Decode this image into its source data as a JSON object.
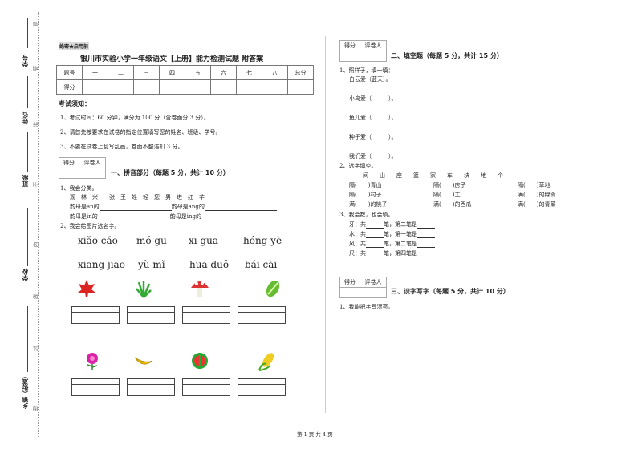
{
  "margin": {
    "labels": [
      "学号",
      "姓名",
      "班级",
      "学校",
      "乡镇（街道）"
    ],
    "seal_chars": [
      "题",
      "答",
      "准",
      "不",
      "内",
      "线",
      "封",
      "密"
    ]
  },
  "header": {
    "stamp": "绝密★启用前",
    "title": "银川市实验小学一年级语文【上册】能力检测试题 附答案"
  },
  "score_table": {
    "headers": [
      "题号",
      "一",
      "二",
      "三",
      "四",
      "五",
      "六",
      "七",
      "八",
      "总分"
    ],
    "row_label": "得分"
  },
  "notice": {
    "title": "考试须知：",
    "items": [
      "1、考试时间：60 分钟，满分为 100 分（含卷面分 3 分）。",
      "2、请首先按要求在试卷的指定位置填写您的姓名、班级、学号。",
      "3、不要在试卷上乱写乱画，卷面不整洁扣 3 分。"
    ]
  },
  "grader": {
    "score": "得分",
    "reviewer": "评卷人"
  },
  "section1": {
    "title": "一、拼音部分（每题 5 分，共计 10 分）",
    "q1": "1、我会分类。",
    "chars": "观　林　兴　　张　王　姓　轻　您　男　进　红　芊",
    "rows": [
      [
        "韵母是an的",
        "韵母是ang的"
      ],
      [
        "韵母是in的",
        "韵母是ing的"
      ]
    ],
    "q2": "2、我会给图片选名字。",
    "pinyin": [
      "xiǎo cǎo",
      "mó gu",
      "xī guā",
      "hóng yè",
      "xiāng jiāo",
      "yù mǐ",
      "huā duǒ",
      "bái cài"
    ],
    "pictures": [
      "maple-leaf",
      "grass",
      "mushroom",
      "cabbage",
      "flower",
      "banana",
      "watermelon",
      "corn"
    ]
  },
  "section2": {
    "title": "二、填空题（每题 5 分，共计 15 分）",
    "q1": "1、照样子，填一填：",
    "example": "白云爱（蓝天）。",
    "blanks": [
      "小鸟爱（　　　）。",
      "鱼儿爱（　　　）。",
      "种子爱（　　　）。",
      "我们爱（　　　）。"
    ],
    "q2": "2、选字填空。",
    "choices": "间　　山　　座　　篮　　家　　车　　块　　地　　个",
    "fill": [
      [
        "隔(　　)青山",
        "隔(　　)房子",
        "隔(　　)草地"
      ],
      [
        "隔(　　)村子",
        "隔(　　)工厂",
        "满(　　)的绿树"
      ],
      [
        "满(　　)的桃子",
        "满(　　)的西瓜",
        "满(　　)的青菜"
      ]
    ],
    "q3": "3、我会数，也会填。",
    "strokes": [
      [
        "牙：共",
        "笔，第二笔是"
      ],
      [
        "水：共",
        "笔，第一笔是"
      ],
      [
        "风：共",
        "笔，第二笔是"
      ],
      [
        "尺：共",
        "笔，第四笔是"
      ]
    ]
  },
  "section3": {
    "title": "三、识字写字（每题 5 分，共计 10 分）",
    "q1": "1、我能把字写漂亮。"
  },
  "footer": "第 1 页 共 4 页"
}
